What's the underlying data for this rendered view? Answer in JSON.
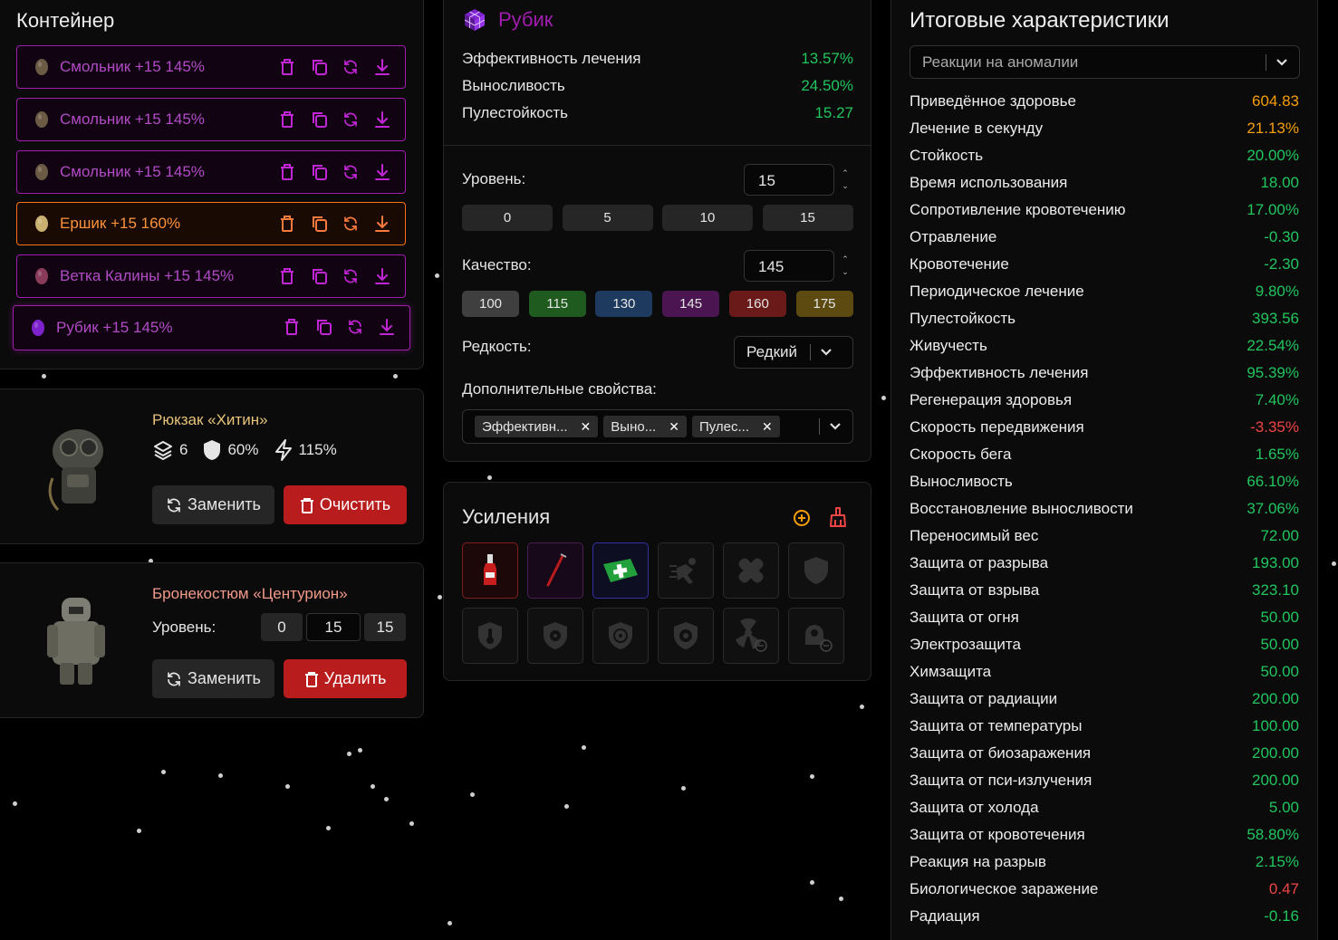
{
  "container": {
    "title": "Контейнер",
    "artifacts": [
      {
        "label": "Смольник +15 145%",
        "tone": "purple"
      },
      {
        "label": "Смольник +15 145%",
        "tone": "purple"
      },
      {
        "label": "Смольник +15 145%",
        "tone": "purple"
      },
      {
        "label": "Ершик +15 160%",
        "tone": "orange"
      },
      {
        "label": "Ветка Калины +15 145%",
        "tone": "purple"
      },
      {
        "label": "Рубик +15 145%",
        "tone": "purple"
      }
    ]
  },
  "backpack": {
    "name": "Рюкзак «Хитин»",
    "slots": "6",
    "protection": "60%",
    "efficiency": "115%",
    "replace_label": "Заменить",
    "clear_label": "Очистить"
  },
  "armor": {
    "name": "Бронекостюм «Центурион»",
    "level_label": "Уровень:",
    "levels": [
      "0",
      "15",
      "15"
    ],
    "replace_label": "Заменить",
    "delete_label": "Удалить"
  },
  "rubik": {
    "title": "Рубик",
    "props": [
      {
        "name": "Эффективность лечения",
        "value": "13.57%"
      },
      {
        "name": "Выносливость",
        "value": "24.50%"
      },
      {
        "name": "Пулестойкость",
        "value": "15.27"
      }
    ],
    "level_label": "Уровень:",
    "level_value": "15",
    "level_presets": [
      "0",
      "5",
      "10",
      "15"
    ],
    "quality_label": "Качество:",
    "quality_value": "145",
    "quality_presets": [
      {
        "label": "100",
        "color": "#3f3f3f"
      },
      {
        "label": "115",
        "color": "#1f5a1f"
      },
      {
        "label": "130",
        "color": "#1e3a5f"
      },
      {
        "label": "145",
        "color": "#4a1550"
      },
      {
        "label": "160",
        "color": "#6b1a1a"
      },
      {
        "label": "175",
        "color": "#5c4a10"
      }
    ],
    "rarity_label": "Редкость:",
    "rarity_value": "Редкий",
    "extra_label": "Дополнительные свойства:",
    "extra_chips": [
      "Эффективн...",
      "Выно...",
      "Пулес..."
    ]
  },
  "boosts": {
    "title": "Усиления",
    "slots": [
      {
        "icon": "bottle-icon",
        "tone": "r"
      },
      {
        "icon": "syringe-icon",
        "tone": "p"
      },
      {
        "icon": "medkit-icon",
        "tone": "b"
      },
      {
        "icon": "running-man-icon",
        "tone": ""
      },
      {
        "icon": "bandage-icon",
        "tone": ""
      },
      {
        "icon": "shield-icon",
        "tone": ""
      },
      {
        "icon": "thermo-shield-icon",
        "tone": ""
      },
      {
        "icon": "radiation-shield-icon",
        "tone": ""
      },
      {
        "icon": "biohazard-shield-icon",
        "tone": ""
      },
      {
        "icon": "psi-shield-icon",
        "tone": ""
      },
      {
        "icon": "radiation-minus-icon",
        "tone": ""
      },
      {
        "icon": "psi-minus-icon",
        "tone": ""
      }
    ]
  },
  "summary": {
    "title": "Итоговые характеристики",
    "filter_value": "Реакции на аномалии",
    "stats": [
      {
        "name": "Приведённое здоровье",
        "value": "604.83",
        "color": "orange"
      },
      {
        "name": "Лечение в секунду",
        "value": "21.13%",
        "color": "orange"
      },
      {
        "name": "Стойкость",
        "value": "20.00%",
        "color": "green"
      },
      {
        "name": "Время использования",
        "value": "18.00",
        "color": "green"
      },
      {
        "name": "Сопротивление кровотечению",
        "value": "17.00%",
        "color": "green"
      },
      {
        "name": "Отравление",
        "value": "-0.30",
        "color": "green"
      },
      {
        "name": "Кровотечение",
        "value": "-2.30",
        "color": "green"
      },
      {
        "name": "Периодическое лечение",
        "value": "9.80%",
        "color": "green"
      },
      {
        "name": "Пулестойкость",
        "value": "393.56",
        "color": "green"
      },
      {
        "name": "Живучесть",
        "value": "22.54%",
        "color": "green"
      },
      {
        "name": "Эффективность лечения",
        "value": "95.39%",
        "color": "green"
      },
      {
        "name": "Регенерация здоровья",
        "value": "7.40%",
        "color": "green"
      },
      {
        "name": "Скорость передвижения",
        "value": "-3.35%",
        "color": "red"
      },
      {
        "name": "Скорость бега",
        "value": "1.65%",
        "color": "green"
      },
      {
        "name": "Выносливость",
        "value": "66.10%",
        "color": "green"
      },
      {
        "name": "Восстановление выносливости",
        "value": "37.06%",
        "color": "green"
      },
      {
        "name": "Переносимый вес",
        "value": "72.00",
        "color": "green"
      },
      {
        "name": "Защита от разрыва",
        "value": "193.00",
        "color": "green"
      },
      {
        "name": "Защита от взрыва",
        "value": "323.10",
        "color": "green"
      },
      {
        "name": "Защита от огня",
        "value": "50.00",
        "color": "green"
      },
      {
        "name": "Электрозащита",
        "value": "50.00",
        "color": "green"
      },
      {
        "name": "Химзащита",
        "value": "50.00",
        "color": "green"
      },
      {
        "name": "Защита от радиации",
        "value": "200.00",
        "color": "green"
      },
      {
        "name": "Защита от температуры",
        "value": "100.00",
        "color": "green"
      },
      {
        "name": "Защита от биозаражения",
        "value": "200.00",
        "color": "green"
      },
      {
        "name": "Защита от пси-излучения",
        "value": "200.00",
        "color": "green"
      },
      {
        "name": "Защита от холода",
        "value": "5.00",
        "color": "green"
      },
      {
        "name": "Защита от кровотечения",
        "value": "58.80%",
        "color": "green"
      },
      {
        "name": "Реакция на разрыв",
        "value": "2.15%",
        "color": "green"
      },
      {
        "name": "Биологическое заражение",
        "value": "0.47",
        "color": "red"
      },
      {
        "name": "Радиация",
        "value": "-0.16",
        "color": "green"
      }
    ]
  }
}
